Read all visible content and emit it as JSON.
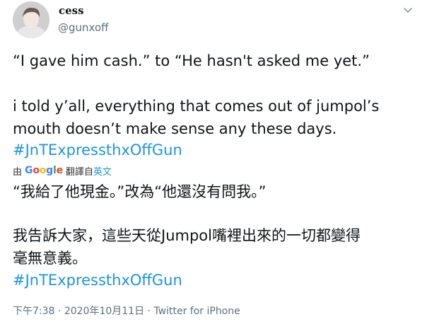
{
  "user": {
    "name": "cess",
    "handle": "@gunxoff"
  },
  "tweet": {
    "line1": "“I gave him cash.” to “He hasn't asked me yet.”",
    "line2": "i told y’all, everything that comes out of jumpol’s",
    "line3": "mouth doesn’t make sense any these days.",
    "hashtag": "#JnTExpressthxOffGun"
  },
  "translation": {
    "prefix": "由",
    "provider": "Google",
    "label": "翻譯自",
    "source_lang": "英文",
    "line1": "“我給了他現金。”改為“他還沒有問我。”",
    "line2": "我告訴大家，這些天從Jumpol嘴裡出來的一切都變得",
    "line3": "毫無意義。",
    "hashtag": "#JnTExpressthxOffGun"
  },
  "footer": {
    "time": "下午7:38",
    "sep1": "·",
    "date": "2020年10月11日",
    "sep2": "·",
    "source": "Twitter for iPhone"
  },
  "colors": {
    "link": "#1b95e0",
    "muted": "#5b7083",
    "google_blue": "#4285F4",
    "google_red": "#EA4335",
    "google_yellow": "#FBBC05",
    "google_green": "#34A853"
  }
}
